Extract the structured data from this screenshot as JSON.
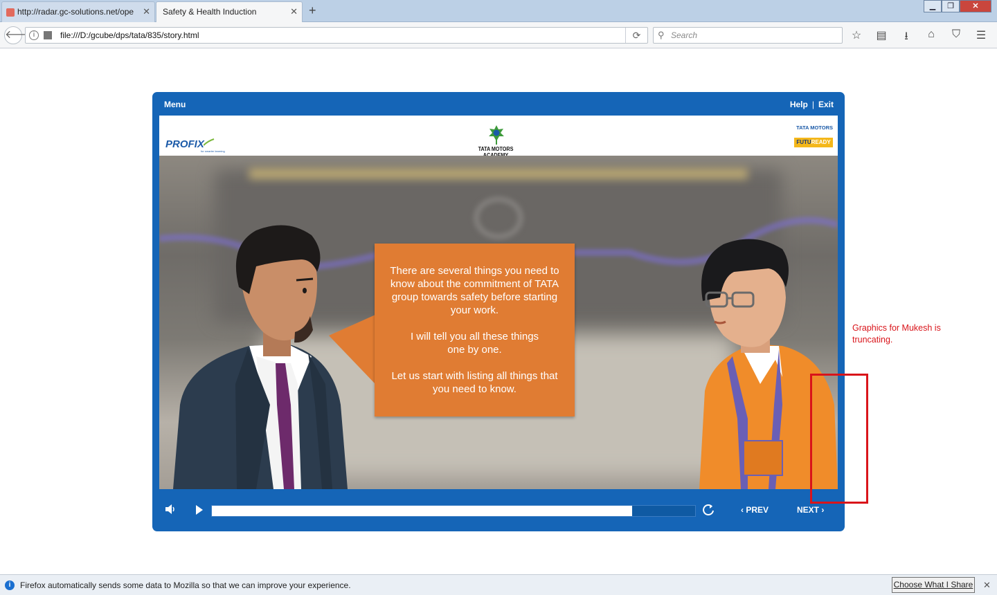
{
  "browser": {
    "tabs": [
      {
        "title": "http://radar.gc-solutions.net/ope",
        "active": false
      },
      {
        "title": "Safety & Health Induction",
        "active": true
      }
    ],
    "url": "file:///D:/gcube/dps/tata/835/story.html",
    "search_placeholder": "Search",
    "toolbar_icons": [
      "bookmark-star-icon",
      "reading-list-icon",
      "download-icon",
      "home-icon",
      "pocket-icon",
      "hamburger-menu-icon"
    ]
  },
  "player": {
    "menu_label": "Menu",
    "help_label": "Help",
    "separator": "|",
    "exit_label": "Exit",
    "logos": {
      "profix": "PROFIX",
      "profix_tagline": "for smarter learning",
      "academy": "TATA MOTORS ACADEMY",
      "tata_motors": "TATA MOTORS",
      "futu": "FUTU",
      "ready": "READY"
    },
    "bubble": {
      "para1": "There are several things you need to know about the commitment of TATA group towards safety before starting your work.",
      "para2": "I will tell you all these things one by one.",
      "para3": "Let us start with listing all things that you need to know."
    },
    "progress_fraction": 0.87,
    "prev_label": "PREV",
    "next_label": "NEXT",
    "colors": {
      "frame": "#1565b7",
      "bubble": "#e07c33",
      "jacket": "#f08c2a"
    }
  },
  "annotation": {
    "note": "Graphics for Mukesh is truncating.",
    "color": "#d9141a"
  },
  "notification": {
    "message": "Firefox automatically sends some data to Mozilla so that we can improve your experience.",
    "button_label": "Choose What I Share"
  }
}
